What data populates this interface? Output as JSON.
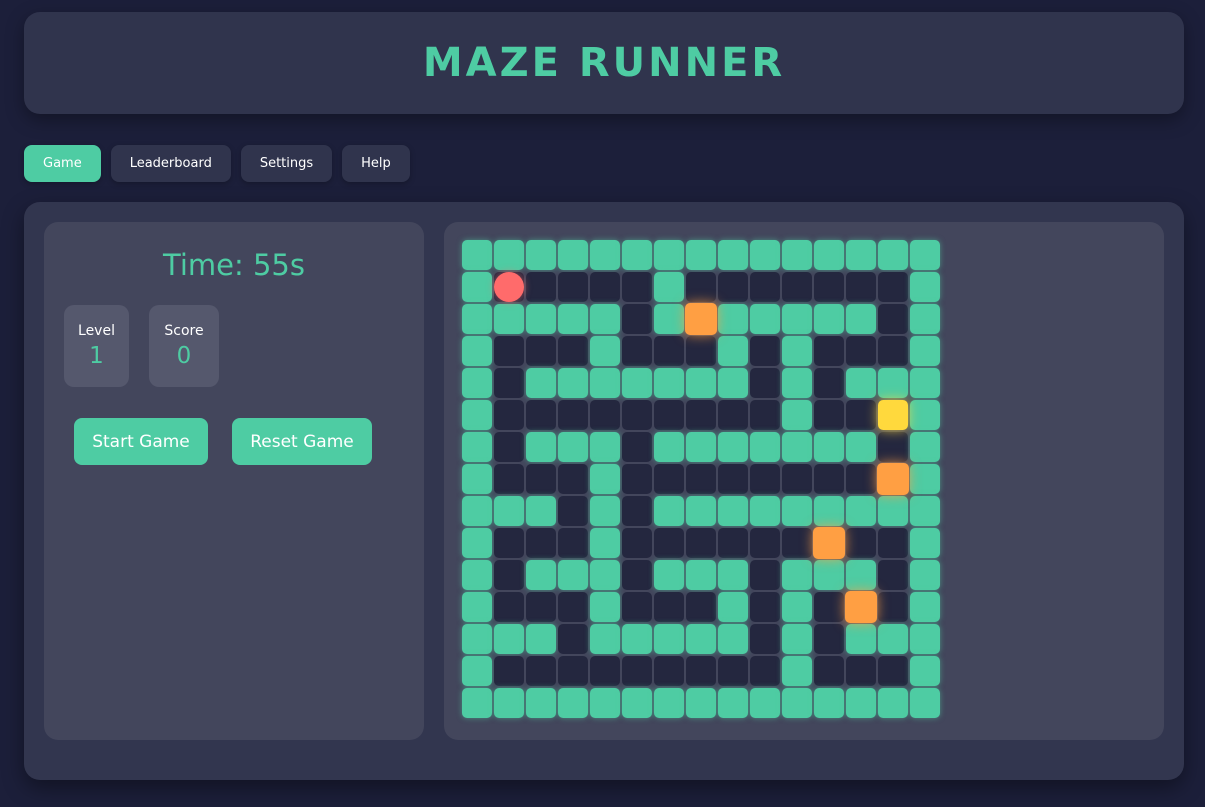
{
  "header": {
    "title": "MAZE RUNNER"
  },
  "nav": {
    "tabs": [
      {
        "label": "Game",
        "active": true
      },
      {
        "label": "Leaderboard",
        "active": false
      },
      {
        "label": "Settings",
        "active": false
      },
      {
        "label": "Help",
        "active": false
      }
    ]
  },
  "stats": {
    "time_text": "Time: 55s",
    "level_label": "Level",
    "level_value": "1",
    "score_label": "Score",
    "score_value": "0"
  },
  "actions": {
    "start_label": "Start Game",
    "reset_label": "Reset Game"
  },
  "colors": {
    "accent": "#4ecca3",
    "background": "#1c1f3a",
    "panel": "#43465c",
    "path": "#24273f",
    "player": "#ff6b6b",
    "coin": "#ff9f43",
    "goal": "#ffd93d"
  },
  "maze": {
    "rows": [
      "111111111111111",
      "100000100000001",
      "111110101111101",
      "100010001010001",
      "101111111010111",
      "100000000010001",
      "101110111111101",
      "100010000000001",
      "111010111111111",
      "100010000000001",
      "101110111011101",
      "100010001010001",
      "111011111010111",
      "100000000010001",
      "111111111111111"
    ],
    "player": {
      "row": 1,
      "col": 1
    },
    "goal": {
      "row": 5,
      "col": 13
    },
    "coins": [
      {
        "row": 2,
        "col": 7
      },
      {
        "row": 7,
        "col": 13
      },
      {
        "row": 9,
        "col": 11
      },
      {
        "row": 11,
        "col": 12
      }
    ]
  }
}
